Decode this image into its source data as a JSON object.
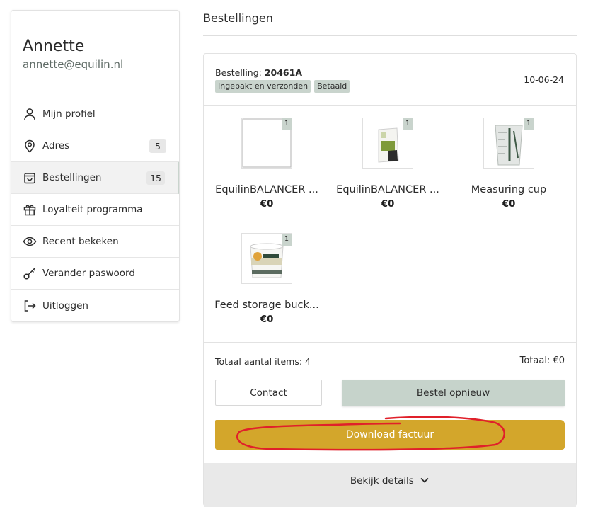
{
  "profile": {
    "name": "Annette",
    "email": "annette@equilin.nl"
  },
  "menu": [
    {
      "label": "Mijn profiel",
      "icon": "user-icon"
    },
    {
      "label": "Adres",
      "icon": "location-pin-icon",
      "badge": "5"
    },
    {
      "label": "Bestellingen",
      "icon": "shopping-bag-icon",
      "badge": "15",
      "active": true
    },
    {
      "label": "Loyalteit programma",
      "icon": "gift-icon"
    },
    {
      "label": "Recent bekeken",
      "icon": "eye-icon"
    },
    {
      "label": "Verander paswoord",
      "icon": "key-icon"
    },
    {
      "label": "Uitloggen",
      "icon": "logout-icon"
    }
  ],
  "page_title": "Bestellingen",
  "order": {
    "label": "Bestelling:",
    "number": "20461A",
    "tags": [
      "Ingepakt en verzonden",
      "Betaald"
    ],
    "date": "10-06-24",
    "products": [
      {
        "name": "EquilinBALANCER ...",
        "price": "€0",
        "qty": "1",
        "image": "blank-image"
      },
      {
        "name": "EquilinBALANCER ...",
        "price": "€0",
        "qty": "1",
        "image": "feed-bag-image"
      },
      {
        "name": "Measuring cup",
        "price": "€0",
        "qty": "1",
        "image": "measuring-cup-image"
      },
      {
        "name": "Feed storage buck...",
        "price": "€0",
        "qty": "1",
        "image": "feed-bucket-image"
      }
    ],
    "total_items": "Totaal aantal items: 4",
    "total": "Totaal: €0",
    "contact_label": "Contact",
    "reorder_label": "Bestel opnieuw",
    "download_label": "Download factuur",
    "details_label": "Bekijk details"
  },
  "colors": {
    "accent_green": "#c9d4cd",
    "download_gold": "#d3a62b",
    "annotation_red": "#e0202a"
  }
}
